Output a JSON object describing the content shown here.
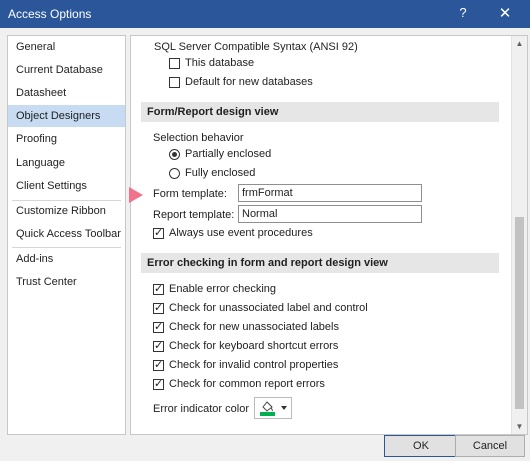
{
  "window": {
    "title": "Access Options",
    "help_label": "?",
    "close_label": "✕"
  },
  "sidebar": {
    "items": [
      {
        "label": "General"
      },
      {
        "label": "Current Database"
      },
      {
        "label": "Datasheet"
      },
      {
        "label": "Object Designers"
      },
      {
        "label": "Proofing"
      },
      {
        "label": "Language"
      },
      {
        "label": "Client Settings"
      },
      {
        "label": "Customize Ribbon"
      },
      {
        "label": "Quick Access Toolbar"
      },
      {
        "label": "Add-ins"
      },
      {
        "label": "Trust Center"
      }
    ],
    "selected": "Object Designers"
  },
  "content": {
    "sql_syntax_label": "SQL Server Compatible Syntax (ANSI 92)",
    "this_database_label": "This database",
    "this_database_checked": false,
    "default_new_db_label": "Default for new databases",
    "default_new_db_checked": false,
    "form_report_header": "Form/Report design view",
    "selection_behavior_label": "Selection behavior",
    "partially_enclosed_label": "Partially enclosed",
    "fully_enclosed_label": "Fully enclosed",
    "selection_behavior_value": "Partially enclosed",
    "form_template_label": "Form template:",
    "form_template_value": "frmFormat",
    "report_template_label": "Report template:",
    "report_template_value": "Normal",
    "always_use_event_label": "Always use event procedures",
    "always_use_event_checked": true,
    "error_checking_header": "Error checking in form and report design view",
    "enable_error_checking_label": "Enable error checking",
    "check_unassociated_label": "Check for unassociated label and control",
    "check_new_unassociated_label": "Check for new unassociated labels",
    "check_keyboard_shortcut_label": "Check for keyboard shortcut errors",
    "check_invalid_props_label": "Check for invalid control properties",
    "check_common_report_label": "Check for common report errors",
    "error_indicator_color_label": "Error indicator color",
    "error_indicator_color": "#00b050"
  },
  "buttons": {
    "ok_label": "OK",
    "cancel_label": "Cancel"
  },
  "colors": {
    "titlebar": "#2b579a",
    "selected_nav": "#c7dbf3",
    "highlight_arrow": "#f1728a"
  }
}
